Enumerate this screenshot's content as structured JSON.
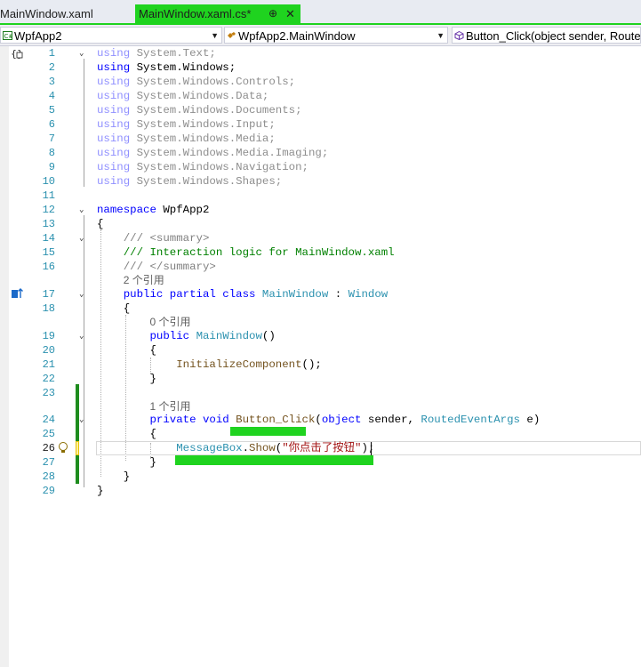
{
  "tabs": [
    {
      "label": "MainWindow.xaml"
    },
    {
      "label": "MainWindow.xaml.cs*",
      "pin": "⊕",
      "close": "✕"
    }
  ],
  "nav": {
    "project": "WpfApp2",
    "class": "WpfApp2.MainWindow",
    "member": "Button_Click(object sender, RoutedEventArgs e)"
  },
  "lens": {
    "class_refs": "2 个引用",
    "ctor_refs": "0 个引用",
    "handler_refs": "1 个引用"
  },
  "code": {
    "l1": "System.Text;",
    "l2": "System.Windows;",
    "l3": "System.Windows.Controls;",
    "l4": "System.Windows.Data;",
    "l5": "System.Windows.Documents;",
    "l6": "System.Windows.Input;",
    "l7": "System.Windows.Media;",
    "l8": "System.Windows.Media.Imaging;",
    "l9": "System.Windows.Navigation;",
    "l10": "System.Windows.Shapes;",
    "using_kw": "using",
    "namespace_kw": "namespace",
    "namespace_name": "WpfApp2",
    "summary_open": "/// <summary>",
    "summary_text": "/// Interaction logic for MainWindow.xaml",
    "summary_close": "/// </summary>",
    "class_decl_kw": "public partial class",
    "class_name": "MainWindow",
    "base_class": "Window",
    "ctor_kw": "public",
    "ctor_name": "MainWindow",
    "init_call": "InitializeComponent",
    "method_kw": "private void",
    "method_name": "Button_Click",
    "param1_kw": "object",
    "param1": "sender,",
    "param2_type": "RoutedEventArgs",
    "param2": "e)",
    "msg_class": "MessageBox",
    "msg_method": "Show",
    "msg_string": "\"你点击了按钮\""
  },
  "line_numbers": [
    "1",
    "2",
    "3",
    "4",
    "5",
    "6",
    "7",
    "8",
    "9",
    "10",
    "11",
    "12",
    "13",
    "14",
    "15",
    "16",
    "17",
    "18",
    "19",
    "20",
    "21",
    "22",
    "23",
    "24",
    "25",
    "26",
    "27",
    "28",
    "29"
  ],
  "colors": {
    "accent_green": "#1fd31f",
    "keyword": "#0000ff",
    "type": "#2b91af",
    "comment": "#008000",
    "string": "#a31515"
  }
}
